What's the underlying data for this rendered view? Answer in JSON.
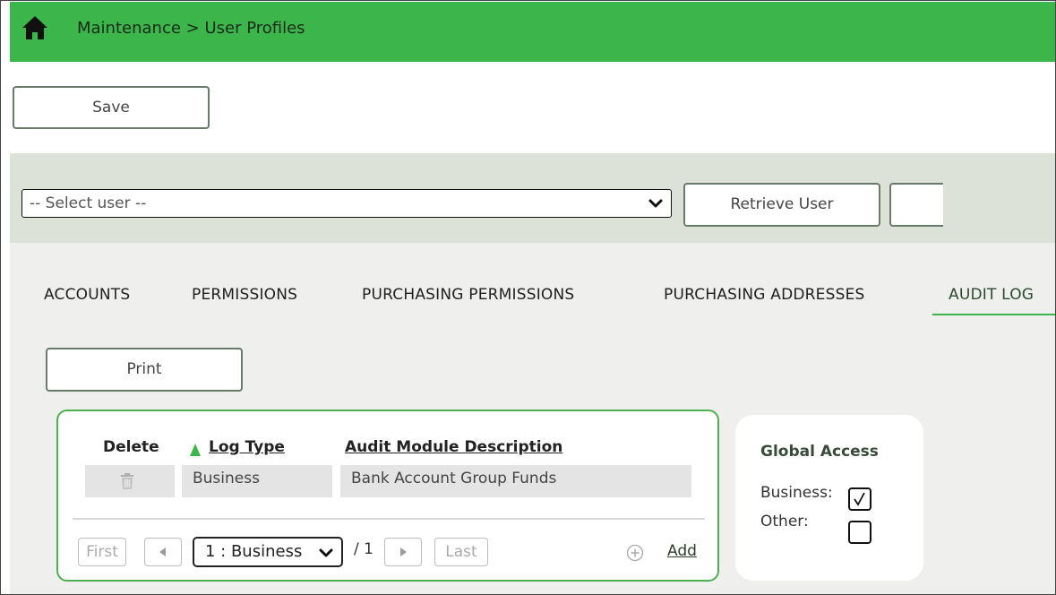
{
  "header": {
    "breadcrumb": "Maintenance > User Profiles",
    "bg_color": "#3cb64a",
    "home_icon": "home-icon"
  },
  "toolbar": {
    "save_label": "Save"
  },
  "user_bar": {
    "select_value": "-- Select user --",
    "retrieve_label": "Retrieve User"
  },
  "tabs": [
    {
      "label": "ACCOUNTS",
      "active": false
    },
    {
      "label": "PERMISSIONS",
      "active": false
    },
    {
      "label": "PURCHASING PERMISSIONS",
      "active": false
    },
    {
      "label": "PURCHASING ADDRESSES",
      "active": false
    },
    {
      "label": "AUDIT LOG",
      "active": true
    }
  ],
  "audit": {
    "print_label": "Print",
    "columns": [
      "Delete",
      "Log Type",
      "Audit Module Description"
    ],
    "rows": [
      {
        "delete_icon": "trash-icon",
        "log_type": "Business",
        "description": "Bank Account Group Funds"
      }
    ],
    "pager": {
      "first": "First",
      "last": "Last",
      "selected": "1 : Business",
      "total": "/ 1",
      "add_label": "Add"
    }
  },
  "global_access": {
    "title": "Global Access",
    "business_label": "Business:",
    "business_checked": true,
    "other_label": "Other:",
    "other_checked": false
  }
}
